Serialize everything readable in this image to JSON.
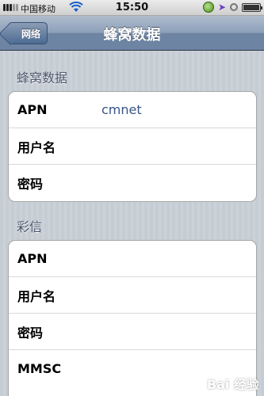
{
  "status_bar": {
    "carrier": "中国移动",
    "time": "15:50"
  },
  "nav": {
    "back_label": "网络",
    "title": "蜂窝数据"
  },
  "cellular_section": {
    "header": "蜂窝数据",
    "rows": [
      {
        "label": "APN",
        "value": "cmnet"
      },
      {
        "label": "用户名",
        "value": ""
      },
      {
        "label": "密码",
        "value": ""
      }
    ]
  },
  "mms_section": {
    "header": "彩信",
    "rows": [
      {
        "label": "APN",
        "value": ""
      },
      {
        "label": "用户名",
        "value": ""
      },
      {
        "label": "密码",
        "value": ""
      },
      {
        "label": "MMSC",
        "value": ""
      }
    ]
  },
  "watermark": "Bai 经验"
}
